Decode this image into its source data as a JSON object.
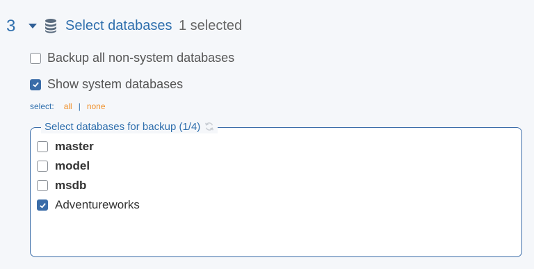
{
  "step": {
    "number": "3",
    "title": "Select databases",
    "selected_count": "1 selected"
  },
  "options": {
    "backup_all": {
      "label": "Backup all non-system databases",
      "checked": false
    },
    "show_system": {
      "label": "Show system databases",
      "checked": true
    }
  },
  "select_links": {
    "label": "select:",
    "all": "all",
    "separator": "|",
    "none": "none"
  },
  "database_list": {
    "legend": "Select databases for backup (1/4)",
    "items": [
      {
        "name": "master",
        "checked": false,
        "system": true
      },
      {
        "name": "model",
        "checked": false,
        "system": true
      },
      {
        "name": "msdb",
        "checked": false,
        "system": true
      },
      {
        "name": "Adventureworks",
        "checked": true,
        "system": false
      }
    ]
  },
  "colors": {
    "accent": "#2f6fad",
    "checkbox_checked": "#3a6ca8",
    "link": "#f0922d",
    "background": "#f5f7fa"
  },
  "icons": {
    "section": "database-icon",
    "collapse": "caret-down-icon",
    "refresh": "refresh-icon"
  }
}
